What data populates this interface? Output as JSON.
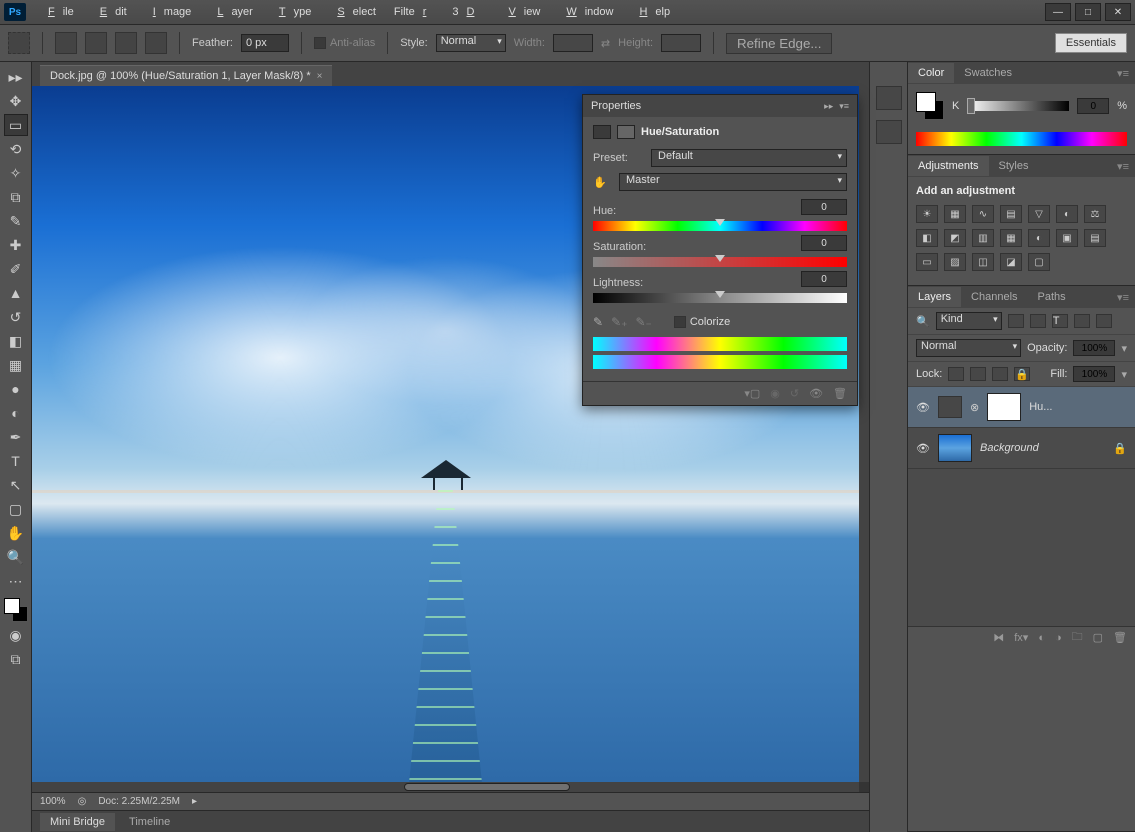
{
  "menu": [
    "File",
    "Edit",
    "Image",
    "Layer",
    "Type",
    "Select",
    "Filter",
    "3D",
    "View",
    "Window",
    "Help"
  ],
  "options": {
    "feather_label": "Feather:",
    "feather_value": "0 px",
    "antialias": "Anti-alias",
    "style_label": "Style:",
    "style_value": "Normal",
    "width_label": "Width:",
    "height_label": "Height:",
    "refine": "Refine Edge...",
    "essentials": "Essentials"
  },
  "doc_tab": "Dock.jpg @ 100% (Hue/Saturation 1, Layer Mask/8) *",
  "status": {
    "zoom": "100%",
    "doc": "Doc: 2.25M/2.25M"
  },
  "footer": {
    "mini": "Mini Bridge",
    "timeline": "Timeline"
  },
  "properties": {
    "title": "Properties",
    "sub": "Hue/Saturation",
    "preset_label": "Preset:",
    "preset_value": "Default",
    "channel": "Master",
    "hue_label": "Hue:",
    "hue_value": "0",
    "sat_label": "Saturation:",
    "sat_value": "0",
    "lig_label": "Lightness:",
    "lig_value": "0",
    "colorize": "Colorize"
  },
  "color_panel": {
    "tab1": "Color",
    "tab2": "Swatches",
    "k": "K",
    "kval": "0",
    "pct": "%"
  },
  "adjust_panel": {
    "tab1": "Adjustments",
    "tab2": "Styles",
    "title": "Add an adjustment"
  },
  "layers_panel": {
    "tab1": "Layers",
    "tab2": "Channels",
    "tab3": "Paths",
    "kind": "Kind",
    "blend": "Normal",
    "opacity_label": "Opacity:",
    "opacity": "100%",
    "lock_label": "Lock:",
    "fill_label": "Fill:",
    "fill": "100%",
    "layer1": "Hu...",
    "layer2": "Background"
  }
}
